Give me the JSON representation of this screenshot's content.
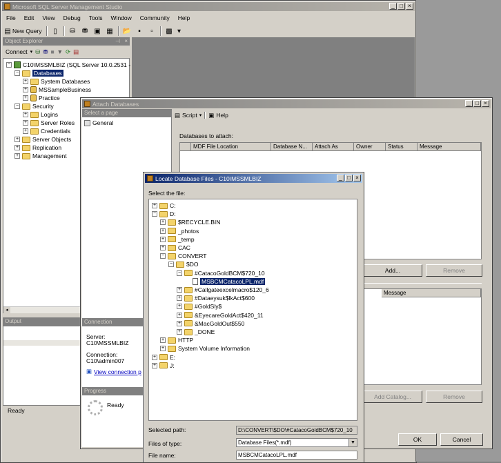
{
  "ssms": {
    "title": "Microsoft SQL Server Management Studio",
    "menus": [
      "File",
      "Edit",
      "View",
      "Debug",
      "Tools",
      "Window",
      "Community",
      "Help"
    ],
    "new_query": "New Query",
    "object_explorer_title": "Object Explorer",
    "connect_label": "Connect",
    "tree": [
      {
        "label": "C10\\MSSMLBIZ (SQL Server 10.0.2531 -",
        "level": 0,
        "pm": "-",
        "icon": "server"
      },
      {
        "label": "Databases",
        "level": 1,
        "pm": "-",
        "icon": "folder",
        "selected": true
      },
      {
        "label": "System Databases",
        "level": 2,
        "pm": "+",
        "icon": "folder"
      },
      {
        "label": "MSSampleBusiness",
        "level": 2,
        "pm": "+",
        "icon": "db"
      },
      {
        "label": "Practice",
        "level": 2,
        "pm": "+",
        "icon": "db"
      },
      {
        "label": "Security",
        "level": 1,
        "pm": "-",
        "icon": "folder"
      },
      {
        "label": "Logins",
        "level": 2,
        "pm": "+",
        "icon": "folder"
      },
      {
        "label": "Server Roles",
        "level": 2,
        "pm": "+",
        "icon": "folder"
      },
      {
        "label": "Credentials",
        "level": 2,
        "pm": "+",
        "icon": "folder"
      },
      {
        "label": "Server Objects",
        "level": 1,
        "pm": "+",
        "icon": "folder"
      },
      {
        "label": "Replication",
        "level": 1,
        "pm": "+",
        "icon": "folder"
      },
      {
        "label": "Management",
        "level": 1,
        "pm": "+",
        "icon": "folder"
      }
    ],
    "output_title": "Output",
    "status": "Ready"
  },
  "attach": {
    "title": "Attach Databases",
    "select_page": "Select a page",
    "general": "General",
    "script": "Script",
    "help": "Help",
    "databases_to_attach": "Databases to attach:",
    "columns": [
      "MDF File Location",
      "Database N...",
      "Attach As",
      "Owner",
      "Status",
      "Message"
    ],
    "details_columns": [
      "Message"
    ],
    "add": "Add...",
    "remove": "Remove",
    "add_catalog": "Add Catalog...",
    "remove2": "Remove",
    "ok": "OK",
    "cancel": "Cancel",
    "connection_hdr": "Connection",
    "server_label": "Server:",
    "server_value": "C10\\MSSMLBIZ",
    "connection_label": "Connection:",
    "connection_value": "C10\\admin007",
    "view_connection": "View connection p",
    "progress_hdr": "Progress",
    "progress_status": "Ready"
  },
  "locate": {
    "title": "Locate Database Files - C10\\MSSMLBIZ",
    "select_file": "Select the file:",
    "tree": [
      {
        "label": "C:",
        "level": 0,
        "pm": "+",
        "icon": "folder"
      },
      {
        "label": "D:",
        "level": 0,
        "pm": "-",
        "icon": "folder"
      },
      {
        "label": "$RECYCLE.BIN",
        "level": 1,
        "pm": "+",
        "icon": "folder"
      },
      {
        "label": "_photos",
        "level": 1,
        "pm": "+",
        "icon": "folder"
      },
      {
        "label": "_temp",
        "level": 1,
        "pm": "+",
        "icon": "folder"
      },
      {
        "label": "CAC",
        "level": 1,
        "pm": "+",
        "icon": "folder"
      },
      {
        "label": "CONVERT",
        "level": 1,
        "pm": "-",
        "icon": "folder"
      },
      {
        "label": "$DO",
        "level": 2,
        "pm": "-",
        "icon": "folder"
      },
      {
        "label": "#CatacoGoldBCM$720_10",
        "level": 3,
        "pm": "-",
        "icon": "folder"
      },
      {
        "label": "MSBCMCatacoLPL.mdf",
        "level": 4,
        "pm": "",
        "icon": "file",
        "selected": true
      },
      {
        "label": "#Callgateexcelmacro$120_6",
        "level": 3,
        "pm": "+",
        "icon": "folder"
      },
      {
        "label": "#Dataeysuk$lkAct$600",
        "level": 3,
        "pm": "+",
        "icon": "folder"
      },
      {
        "label": "#GoldSly$",
        "level": 3,
        "pm": "+",
        "icon": "folder"
      },
      {
        "label": "&EyecareGoldAct$420_11",
        "level": 3,
        "pm": "+",
        "icon": "folder"
      },
      {
        "label": "&MacGoldOut$550",
        "level": 3,
        "pm": "+",
        "icon": "folder"
      },
      {
        "label": "_DONE",
        "level": 3,
        "pm": "+",
        "icon": "folder"
      },
      {
        "label": "HTTP",
        "level": 1,
        "pm": "+",
        "icon": "folder"
      },
      {
        "label": "System Volume Information",
        "level": 1,
        "pm": "+",
        "icon": "folder"
      },
      {
        "label": "E:",
        "level": 0,
        "pm": "+",
        "icon": "folder"
      },
      {
        "label": "J:",
        "level": 0,
        "pm": "+",
        "icon": "folder"
      }
    ],
    "selected_path_label": "Selected path:",
    "selected_path": "D:\\CONVERT\\$DO\\#CatacoGoldBCM$720_10",
    "file_type_label": "Files of type:",
    "file_type": "Database Files(*.mdf)",
    "file_name_label": "File name:",
    "file_name": "MSBCMCatacoLPL.mdf"
  }
}
